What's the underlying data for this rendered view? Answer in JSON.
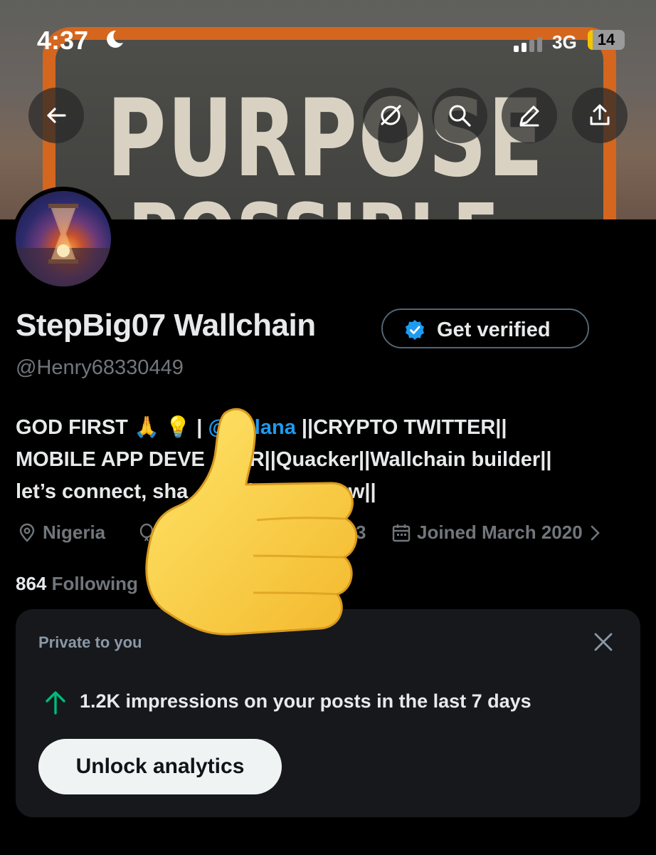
{
  "status_bar": {
    "time": "4:37",
    "network": "3G",
    "battery": "14",
    "battery_level": 0.14
  },
  "banner": {
    "text": "PURPOSE",
    "text_partial": "POSSIBLE"
  },
  "nav": {
    "back_icon": "arrow-left-icon",
    "grok_icon": "grok-icon",
    "search_icon": "search-icon",
    "edit_icon": "edit-icon",
    "share_icon": "share-icon"
  },
  "profile": {
    "name": "StepBig07 Wallchain",
    "get_verified_label": "Get verified",
    "handle": "@Henry68330449",
    "bio": {
      "prefix": "GOD FIRST 🙏 💡 | ",
      "mention": "@Solana",
      "rest": " ||CRYPTO TWITTER||",
      "line2": "MOBILE APP DEVE   PER||Quacker||Wallchain builder||",
      "line3": "let’s connect, sha   nsight   nd grow||"
    },
    "location": "Nigeria",
    "birthday_partial": "Bo",
    "birthday_tail": "3",
    "joined": "Joined March 2020",
    "following_count": "864",
    "following_label": "Following"
  },
  "analytics_card": {
    "label": "Private to you",
    "impressions_text": "1.2K impressions on your posts in the last 7 days",
    "button_label": "Unlock analytics"
  },
  "colors": {
    "accent": "#1d9bf0",
    "positive": "#00ba7c",
    "muted": "#71767b"
  }
}
